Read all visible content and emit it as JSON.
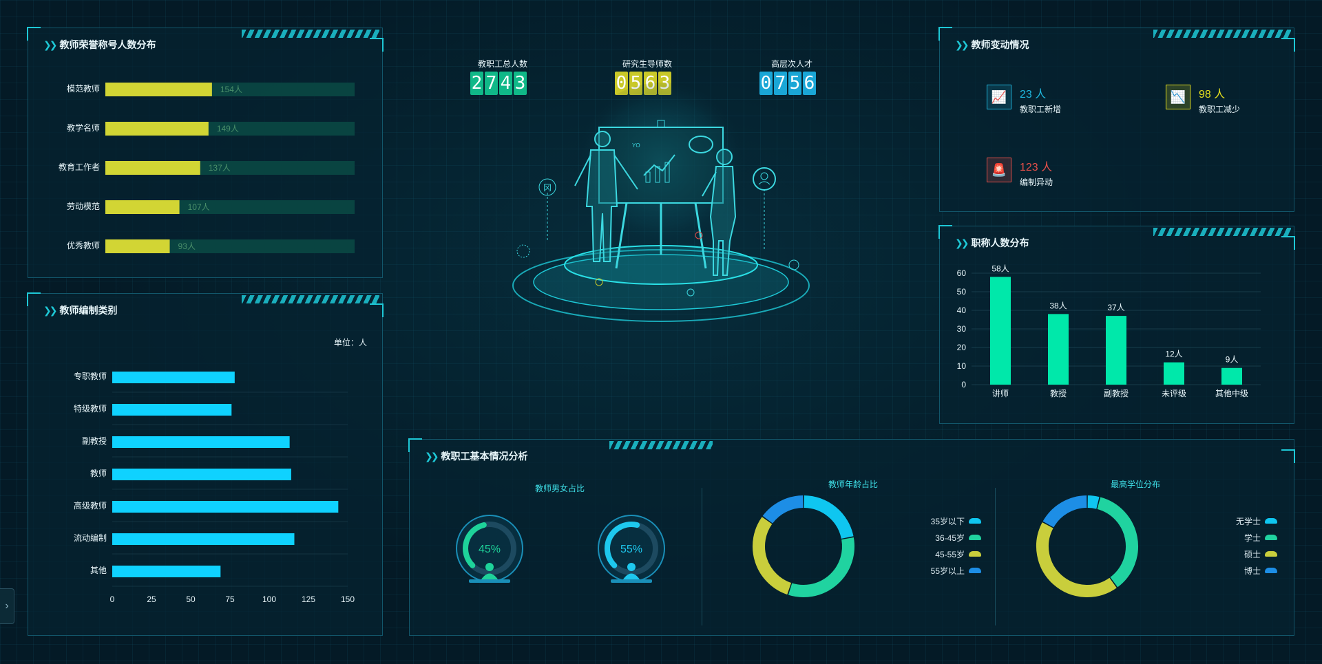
{
  "honor_panel": {
    "title": "教师荣誉称号人数分布",
    "max": 360,
    "items": [
      {
        "label": "模范教师",
        "value": 154,
        "text": "154人"
      },
      {
        "label": "教学名师",
        "value": 149,
        "text": "149人"
      },
      {
        "label": "教育工作者",
        "value": 137,
        "text": "137人"
      },
      {
        "label": "劳动模范",
        "value": 107,
        "text": "107人"
      },
      {
        "label": "优秀教师",
        "value": 93,
        "text": "93人"
      }
    ]
  },
  "staffing_panel": {
    "title": "教师编制类别",
    "unit": "单位：人",
    "chart_data": {
      "type": "bar",
      "orientation": "horizontal",
      "categories": [
        "专职教师",
        "特级教师",
        "副教授",
        "教师",
        "高级教师",
        "流动编制",
        "其他"
      ],
      "values": [
        78,
        76,
        113,
        114,
        144,
        116,
        69
      ],
      "xlim": [
        0,
        150
      ],
      "xticks": [
        "0",
        "25",
        "50",
        "75",
        "100",
        "125",
        "150"
      ],
      "color": "#0fd2ff"
    }
  },
  "counters": [
    {
      "label": "教职工总人数",
      "digits": [
        "2",
        "7",
        "4",
        "3"
      ],
      "color": "#10b888"
    },
    {
      "label": "研究生导师数",
      "digits": [
        "0",
        "5",
        "6",
        "3"
      ],
      "color": "#c9c828"
    },
    {
      "label": "高层次人才",
      "digits": [
        "0",
        "7",
        "5",
        "6"
      ],
      "color": "#1aa6d6"
    }
  ],
  "center_illustration": {
    "board_text": "YO",
    "left_badge": "冈"
  },
  "change_panel": {
    "title": "教师变动情况",
    "items": [
      {
        "number": "23 人",
        "label": "教职工新增",
        "color": "#1fb8e0",
        "icon": "chart-up-icon"
      },
      {
        "number": "98 人",
        "label": "教职工减少",
        "color": "#e6e11e",
        "icon": "chart-down-icon"
      },
      {
        "number": "123 人",
        "label": "编制异动",
        "color": "#e8504a",
        "icon": "alarm-icon"
      }
    ]
  },
  "title_panel": {
    "title": "职称人数分布",
    "chart_data": {
      "type": "bar",
      "categories": [
        "讲师",
        "教授",
        "副教授",
        "未评级",
        "其他中级"
      ],
      "values": [
        58,
        38,
        37,
        12,
        9
      ],
      "data_labels": [
        "58人",
        "38人",
        "37人",
        "12人",
        "9人"
      ],
      "ylim": [
        0,
        60
      ],
      "yticks": [
        "0",
        "10",
        "20",
        "30",
        "40",
        "50",
        "60"
      ],
      "color": "#00e8aa",
      "grid": true
    }
  },
  "basic_panel": {
    "title": "教职工基本情况分析",
    "gender": {
      "title": "教师男女占比",
      "female": {
        "value": 0.45,
        "text": "45%",
        "color": "#1ed39a"
      },
      "male": {
        "value": 0.55,
        "text": "55%",
        "color": "#1ec8ee"
      }
    },
    "age": {
      "title": "教师年龄占比",
      "chart_data": {
        "type": "pie",
        "donut": true,
        "categories": [
          "35岁以下",
          "36-45岁",
          "45-55岁",
          "55岁以上"
        ],
        "values": [
          22,
          33,
          30,
          15
        ],
        "colors": [
          "#0fc6f0",
          "#20d3a0",
          "#c9ce3c",
          "#1d8ee6"
        ]
      }
    },
    "degree": {
      "title": "最高学位分布",
      "chart_data": {
        "type": "pie",
        "donut": true,
        "categories": [
          "无学士",
          "学士",
          "硕士",
          "博士"
        ],
        "values": [
          4,
          36,
          43,
          17
        ],
        "colors": [
          "#0fc6f0",
          "#20d3a0",
          "#c9ce3c",
          "#1d8ee6"
        ]
      }
    }
  },
  "side_tab": {
    "glyph": "›"
  }
}
